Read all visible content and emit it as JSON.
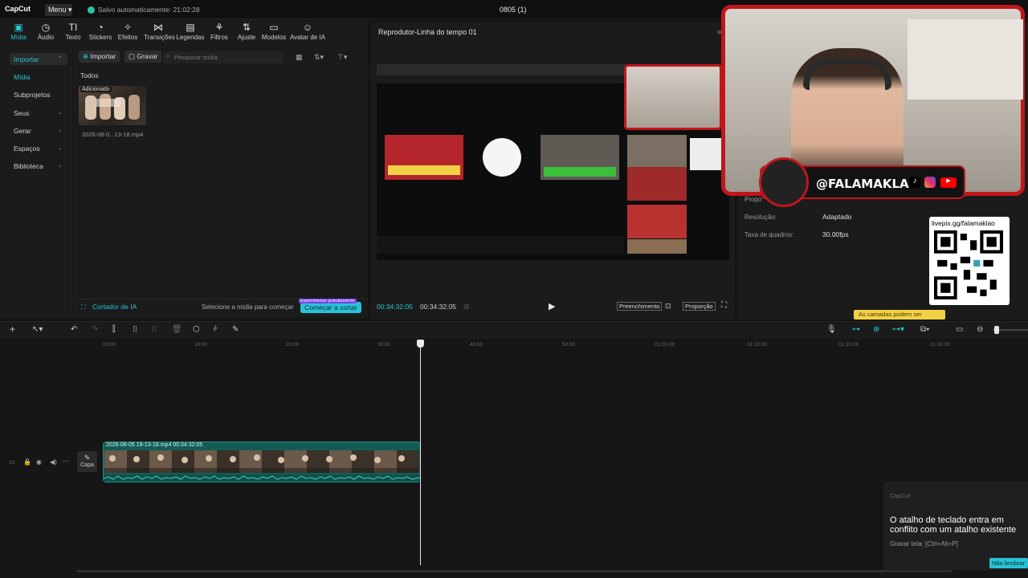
{
  "titlebar": {
    "logo": "CapCut",
    "menu_label": "Menu ▾",
    "autosave": "Salvo automaticamente: 21:02:28",
    "project_title": "0805 (1)"
  },
  "toolbar": {
    "items": [
      {
        "label": "Mídia",
        "icon": "media-icon"
      },
      {
        "label": "Áudio",
        "icon": "audio-icon"
      },
      {
        "label": "Texto",
        "icon": "text-icon"
      },
      {
        "label": "Stickers",
        "icon": "sticker-icon"
      },
      {
        "label": "Efeitos",
        "icon": "effects-icon"
      },
      {
        "label": "Transições",
        "icon": "transitions-icon"
      },
      {
        "label": "Legendas",
        "icon": "captions-icon"
      },
      {
        "label": "Filtros",
        "icon": "filters-icon"
      },
      {
        "label": "Ajuste",
        "icon": "adjust-icon"
      },
      {
        "label": "Modelos",
        "icon": "templates-icon"
      },
      {
        "label": "Avatar de IA",
        "icon": "ai-avatar-icon"
      }
    ]
  },
  "sidebar": {
    "items": [
      {
        "label": "Importar"
      },
      {
        "label": "Mídia"
      },
      {
        "label": "Subprojetos"
      },
      {
        "label": "Seus"
      },
      {
        "label": "Gerar"
      },
      {
        "label": "Espaços"
      },
      {
        "label": "Biblioteca"
      }
    ]
  },
  "media": {
    "import_label": "Importar",
    "record_label": "Gravar",
    "search_placeholder": "Pesquisar mídia",
    "filter_label": "Todos",
    "thumb_badge": "Adicionado",
    "thumb_name": "2026-08-0...13-18.mp4",
    "ai_cut_label": "Cortador de IA",
    "ai_cut_hint": "Selecione a mídia para começar",
    "ai_cut_tag": "Experimentar gratuitamente",
    "ai_cut_button": "Começar a cortar"
  },
  "player": {
    "title": "Reprodutor-Linha do tempo 01",
    "time_current": "00:34:32:05",
    "time_total": "00:34:32:05",
    "fill_label": "Preenchimento",
    "ratio_label": "Proporção"
  },
  "props": {
    "partial_label": "Propo",
    "resolution_label": "Resolução:",
    "resolution_value": "Adaptado",
    "framerate_label": "Taxa de quadros:",
    "framerate_value": "30.00fps",
    "layer_tip": "As camadas podem ser"
  },
  "overlay": {
    "handle": "@FALAMAKLAO",
    "qr_label": "livepix.gg/falamaklao"
  },
  "timeline": {
    "ticks": [
      "00:00",
      "10:00",
      "20:00",
      "30:00",
      "40:00",
      "50:00",
      "01:00:00",
      "01:10:00",
      "01:20:00",
      "01:30:00"
    ],
    "capa_label": "Capa",
    "clip_name": "2026-08-05 19-13-18.mp4   00:34:32:05"
  },
  "toast": {
    "app": "CapCut",
    "message": "O atalho de teclado entra em conflito com um atalho existente",
    "sub": "Gravar tela: [Ctrl+Alt+P]",
    "button": "Não lembrar"
  },
  "colors": {
    "accent": "#29c3d7",
    "clip": "#155b55",
    "overlay_red": "#c0161c"
  }
}
